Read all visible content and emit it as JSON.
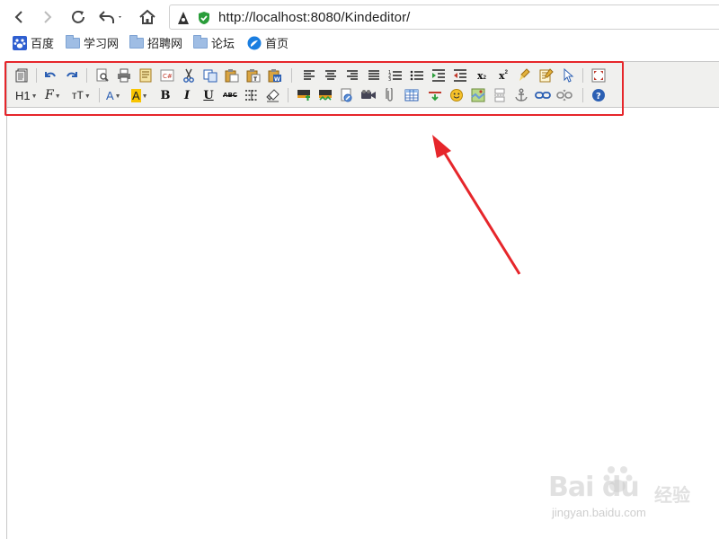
{
  "browser": {
    "url": "http://localhost:8080/Kindeditor/",
    "nav": [
      "back-icon",
      "forward-icon",
      "reload-icon",
      "undo-close-tab-icon",
      "home-icon"
    ],
    "bookmarks": [
      {
        "label": "百度",
        "icon": "baidu-paw-icon"
      },
      {
        "label": "学习网",
        "icon": "folder-icon"
      },
      {
        "label": "招聘网",
        "icon": "folder-icon"
      },
      {
        "label": "论坛",
        "icon": "folder-icon"
      },
      {
        "label": "首页",
        "icon": "globe-icon"
      }
    ]
  },
  "toolbar": {
    "row1": [
      "source",
      "undo",
      "redo",
      "preview",
      "print",
      "template",
      "code",
      "cut",
      "copy",
      "paste",
      "plainpaste",
      "wordpaste",
      "justifyleft",
      "justifycenter",
      "justifyright",
      "justifyfull",
      "insertorderedlist",
      "insertunorderedlist",
      "indent",
      "outdent",
      "subscript",
      "superscript",
      "clearhtml",
      "quickformat",
      "selectall",
      "fullscreen"
    ],
    "row2": [
      "formatblock",
      "fontname",
      "fontsize",
      "forecolor",
      "hilitecolor",
      "bold",
      "italic",
      "underline",
      "strikethrough",
      "lineheight",
      "removeformat",
      "image",
      "multiimage",
      "flash",
      "media",
      "insertfile",
      "table",
      "hr",
      "emoticons",
      "baidumap",
      "pagebreak",
      "anchor",
      "link",
      "unlink",
      "about"
    ],
    "heading_label": "H1",
    "fontname_label": "F",
    "fontsize_label": "тT",
    "forecolor_label": "A",
    "hilitecolor_label": "A",
    "bold_label": "B",
    "italic_label": "I",
    "underline_label": "U",
    "strike_label": "ABC",
    "sub_label": "x",
    "sup_label": "x",
    "colors": {
      "highlight": "#f8c400",
      "accent": "#1d5fb4",
      "annotation": "#e6262b"
    }
  },
  "watermark": {
    "logo": "Bai du",
    "cn": "经验",
    "url": "jingyan.baidu.com"
  }
}
